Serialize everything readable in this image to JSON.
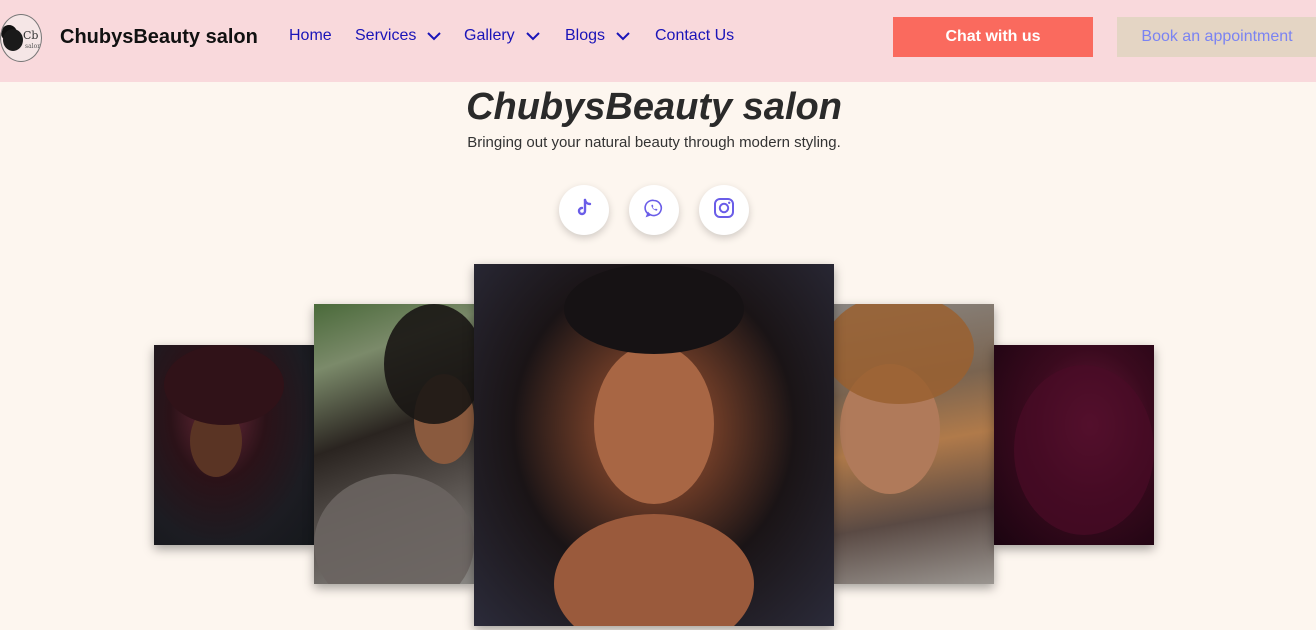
{
  "brand": {
    "name": "ChubysBeauty salon",
    "logo_icon": "salon-logo-icon",
    "logo_text": "Cb",
    "logo_subtext": "salon"
  },
  "nav": {
    "items": [
      {
        "label": "Home",
        "has_dropdown": false
      },
      {
        "label": "Services",
        "has_dropdown": true
      },
      {
        "label": "Gallery",
        "has_dropdown": true
      },
      {
        "label": "Blogs",
        "has_dropdown": true
      },
      {
        "label": "Contact Us",
        "has_dropdown": false
      }
    ]
  },
  "actions": {
    "chat_label": "Chat with us",
    "book_label": "Book an appointment"
  },
  "hero": {
    "title": "ChubysBeauty salon",
    "subtitle": "Bringing out your natural beauty through modern styling."
  },
  "social": [
    {
      "icon": "tiktok-icon"
    },
    {
      "icon": "whatsapp-icon"
    },
    {
      "icon": "instagram-icon"
    }
  ],
  "gallery": {
    "images": [
      {
        "subject": "afro-curly-hair"
      },
      {
        "subject": "cornrow-braids-with-beads"
      },
      {
        "subject": "knotless-box-braids"
      },
      {
        "subject": "bob-wig"
      },
      {
        "subject": "burgundy-wavy-hair"
      }
    ]
  },
  "colors": {
    "header_bg": "#f9d9dc",
    "page_bg": "#fdf6ef",
    "nav_link": "#1a14b8",
    "chat_button": "#fa6a5e",
    "book_button": "#e4d5c4",
    "book_text": "#7a83f2",
    "social_icon": "#6a5de8"
  }
}
